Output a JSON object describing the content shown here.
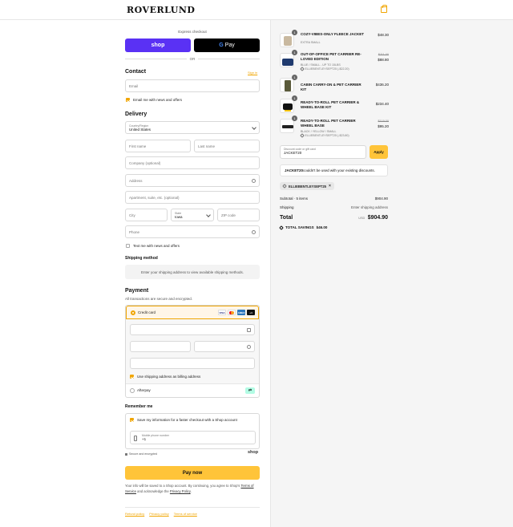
{
  "brand": {
    "logo_text": "ROVERLUND",
    "accent": "#f0a500",
    "button_yellow": "#ffc439",
    "shoppay_purple": "#5a31f4"
  },
  "express": {
    "title": "Express checkout",
    "shoppay_label": "shop",
    "gpay_label": "Pay",
    "or_label": "OR"
  },
  "contact": {
    "heading": "Contact",
    "sign_in": "Sign in",
    "email_placeholder": "Email",
    "news_label": "Email me with news and offers",
    "news_checked": true
  },
  "delivery": {
    "heading": "Delivery",
    "country_label": "Country/Region",
    "country_value": "United States",
    "first_name": "First name",
    "last_name": "Last name",
    "company": "Company (optional)",
    "address": "Address",
    "apartment": "Apartment, suite, etc. (optional)",
    "city": "City",
    "state_label": "State",
    "state_value": "Iowa",
    "zip": "ZIP code",
    "phone": "Phone",
    "text_me_label": "Text me with news and offers",
    "text_me_checked": false
  },
  "shipping_method": {
    "heading": "Shipping method",
    "notice": "Enter your shipping address to view available shipping methods."
  },
  "payment": {
    "heading": "Payment",
    "subtitle": "All transactions are secure and encrypted.",
    "credit_card_label": "Credit card",
    "card_brands": [
      "VISA",
      "MC",
      "AMEX",
      "+4"
    ],
    "billing_same_label": "Use shipping address as billing address",
    "billing_same_checked": true,
    "afterpay_label": "Afterpay"
  },
  "remember": {
    "heading": "Remember me",
    "save_label": "Save my information for a faster checkout with a Shop account",
    "save_checked": true,
    "phone_label": "Mobile phone number",
    "phone_value": "+1",
    "secure_label": "Secure and encrypted",
    "shop_logo": "shop"
  },
  "pay_now_label": "Pay now",
  "fine_print": {
    "line1": "Your info will be saved to a Shop account. By continuing, you agree to Shop's",
    "terms": "Terms of Service",
    "mid": "and acknowledge the",
    "privacy": "Privacy Policy",
    "end": "."
  },
  "footer_links": [
    "Refund policy",
    "Privacy policy",
    "Terms of service"
  ],
  "cart": {
    "items": [
      {
        "qty": "1",
        "name": "COZY-VIBES-ONLY FLEECE JACKET",
        "variant": "EXTRA SMALL",
        "discount": "",
        "price": "$48.30",
        "old_price": ""
      },
      {
        "qty": "1",
        "name": "OUT-OF-OFFICE PET CARRIER RE-LOVED EDITION",
        "variant": "BLUE / SMALL - UP TO 15LBS",
        "discount": "ELLIEBENTLEYSEPT25 (-$22.20)",
        "price": "$88.80",
        "old_price": "$111.00"
      },
      {
        "qty": "1",
        "name": "CABIN CARRY-ON & PET CARRIER KIT",
        "variant": "",
        "discount": "",
        "price": "$436.20",
        "old_price": ""
      },
      {
        "qty": "1",
        "name": "READY-TO-ROLL PET CARRIER & WHEEL BASE KIT",
        "variant": "",
        "discount": "",
        "price": "$234.40",
        "old_price": ""
      },
      {
        "qty": "1",
        "name": "READY-TO-ROLL PET CARRIER WHEEL BASE",
        "variant": "BLACK / YELLOW / SMALL",
        "discount": "ELLIEBENTLEYSEPT25 (-$23.80)",
        "price": "$95.20",
        "old_price": "$119.00"
      }
    ],
    "discount_label": "Discount code or gift card",
    "discount_value": "JACKET20",
    "apply_label": "Apply",
    "error_code": "JACKET20",
    "error_text": " couldn't be used with your existing discounts.",
    "applied_code": "ELLIEBENTLEYSEPT25",
    "subtotal_label": "Subtotal · 5 items",
    "subtotal_value": "$904.90",
    "shipping_label": "Shipping",
    "shipping_value": "Enter shipping address",
    "total_label": "Total",
    "currency": "USD",
    "total_value": "$904.90",
    "savings_label": "TOTAL SAVINGS",
    "savings_value": "$46.00"
  }
}
